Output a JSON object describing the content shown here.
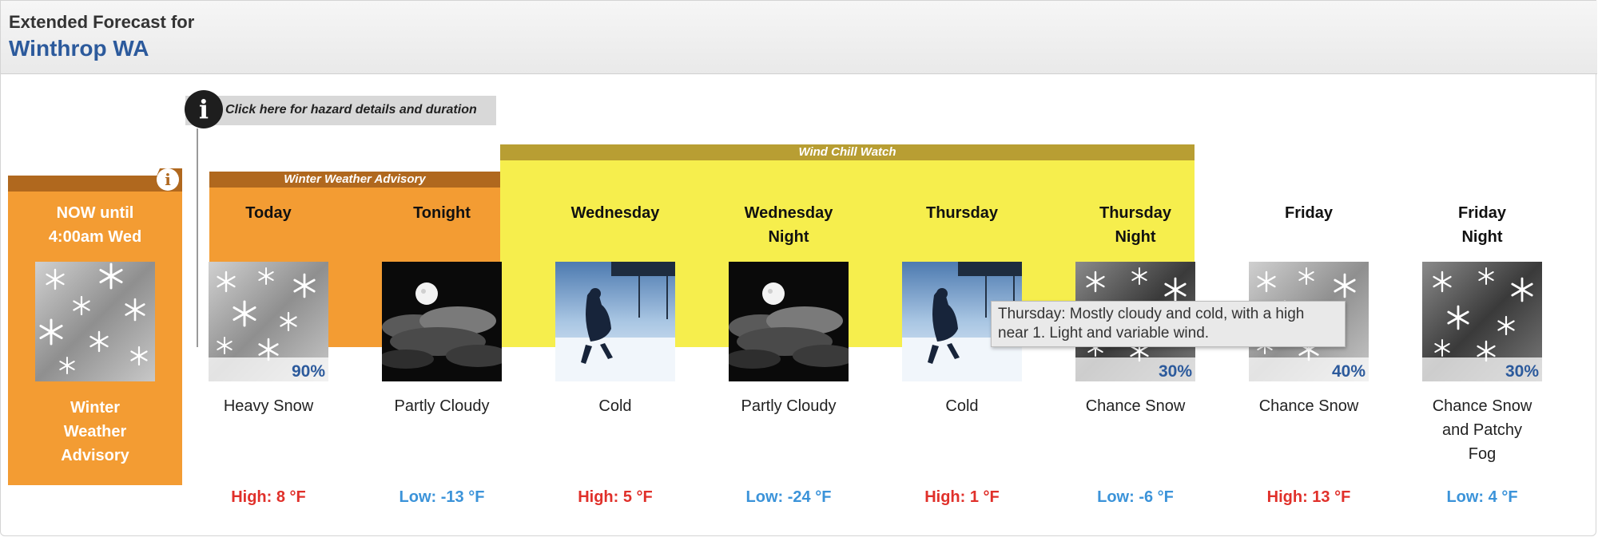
{
  "header": {
    "label": "Extended Forecast for",
    "location": "Winthrop WA"
  },
  "hazard_link": {
    "text": "Click here for hazard details and duration",
    "icon": "info-icon"
  },
  "hazards": [
    {
      "name": "Winter Weather Advisory",
      "color": "#f39c33",
      "header_color": "#b0681e"
    },
    {
      "name": "Wind Chill Watch",
      "color": "#f6ee4d",
      "header_color": "#b89e33"
    }
  ],
  "now": {
    "period": "NOW until\n4:00am Wed",
    "description": "Winter\nWeather\nAdvisory",
    "icon": "snowflakes-icon"
  },
  "periods": [
    {
      "name": "Today",
      "icon": "heavy-snow-icon",
      "pop": "90%",
      "desc": "Heavy Snow",
      "temp": "High: 8 °F",
      "kind": "hi"
    },
    {
      "name": "Tonight",
      "icon": "partly-cloudy-night-icon",
      "pop": "",
      "desc": "Partly Cloudy",
      "temp": "Low: -13 °F",
      "kind": "lo"
    },
    {
      "name": "Wednesday",
      "icon": "cold-icon",
      "pop": "",
      "desc": "Cold",
      "temp": "High: 5 °F",
      "kind": "hi"
    },
    {
      "name": "Wednesday\nNight",
      "icon": "partly-cloudy-night-icon",
      "pop": "",
      "desc": "Partly Cloudy",
      "temp": "Low: -24 °F",
      "kind": "lo"
    },
    {
      "name": "Thursday",
      "icon": "cold-icon",
      "pop": "",
      "desc": "Cold",
      "temp": "High: 1 °F",
      "kind": "hi"
    },
    {
      "name": "Thursday\nNight",
      "icon": "chance-snow-night-icon",
      "pop": "30%",
      "desc": "Chance Snow",
      "temp": "Low: -6 °F",
      "kind": "lo"
    },
    {
      "name": "Friday",
      "icon": "chance-snow-icon",
      "pop": "40%",
      "desc": "Chance Snow",
      "temp": "High: 13 °F",
      "kind": "hi"
    },
    {
      "name": "Friday\nNight",
      "icon": "chance-snow-night-icon",
      "pop": "30%",
      "desc": "Chance Snow\nand Patchy\nFog",
      "temp": "Low: 4 °F",
      "kind": "lo"
    }
  ],
  "tooltip": {
    "text": "Thursday: Mostly cloudy and cold, with a high near 1. Light and variable wind."
  },
  "colors": {
    "high_temp": "#e0302a",
    "low_temp": "#3b93d9",
    "location": "#2c5a9c"
  }
}
